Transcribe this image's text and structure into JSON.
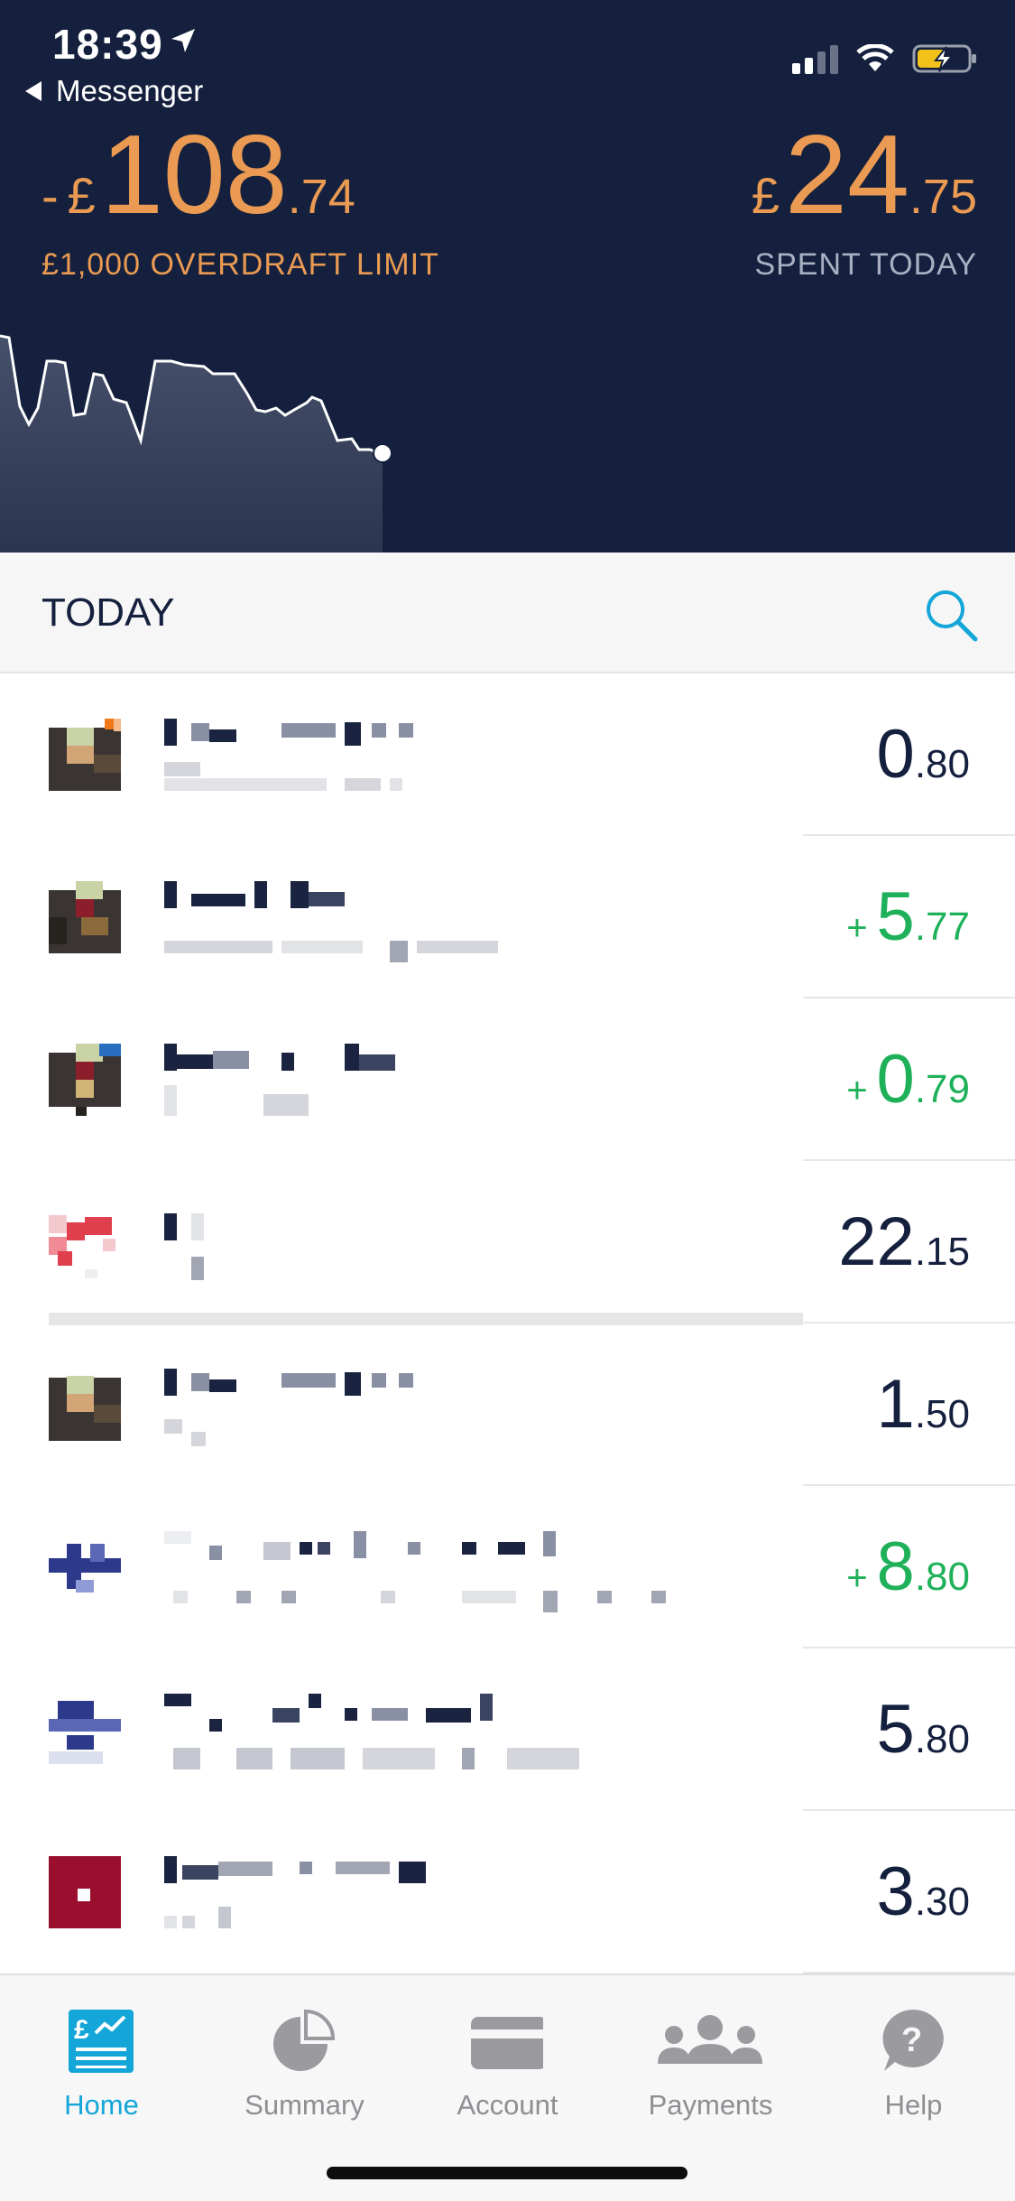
{
  "status_bar": {
    "time": "18:39",
    "back_label": "Messenger",
    "icons": [
      "location-arrow-icon",
      "cellular-signal-icon",
      "wifi-icon",
      "battery-charging-icon"
    ]
  },
  "header": {
    "balance": {
      "sign": "-",
      "currency": "£",
      "whole": "108",
      "fraction": ".74"
    },
    "overdraft_label": "£1,000 OVERDRAFT LIMIT",
    "spent": {
      "currency": "£",
      "whole": "24",
      "fraction": ".75"
    },
    "spent_label": "SPENT TODAY"
  },
  "today": {
    "title": "TODAY",
    "search_icon": "search-icon"
  },
  "transactions": [
    {
      "whole": "0",
      "fraction": ".80",
      "incoming": false,
      "plus": ""
    },
    {
      "whole": "5",
      "fraction": ".77",
      "incoming": true,
      "plus": "+"
    },
    {
      "whole": "0",
      "fraction": ".79",
      "incoming": true,
      "plus": "+"
    },
    {
      "whole": "22",
      "fraction": ".15",
      "incoming": false,
      "plus": ""
    },
    {
      "whole": "1",
      "fraction": ".50",
      "incoming": false,
      "plus": ""
    },
    {
      "whole": "8",
      "fraction": ".80",
      "incoming": true,
      "plus": "+"
    },
    {
      "whole": "5",
      "fraction": ".80",
      "incoming": false,
      "plus": ""
    },
    {
      "whole": "3",
      "fraction": ".30",
      "incoming": false,
      "plus": ""
    }
  ],
  "tabs": [
    {
      "label": "Home",
      "icon": "home-pound-icon",
      "active": true
    },
    {
      "label": "Summary",
      "icon": "pie-chart-icon",
      "active": false
    },
    {
      "label": "Account",
      "icon": "card-icon",
      "active": false
    },
    {
      "label": "Payments",
      "icon": "people-icon",
      "active": false
    },
    {
      "label": "Help",
      "icon": "help-bubble-icon",
      "active": false
    }
  ],
  "colors": {
    "header_bg": "#14203d",
    "accent_orange": "#ea9a52",
    "incoming_green": "#1fb15a",
    "tab_active": "#14a6d8"
  }
}
